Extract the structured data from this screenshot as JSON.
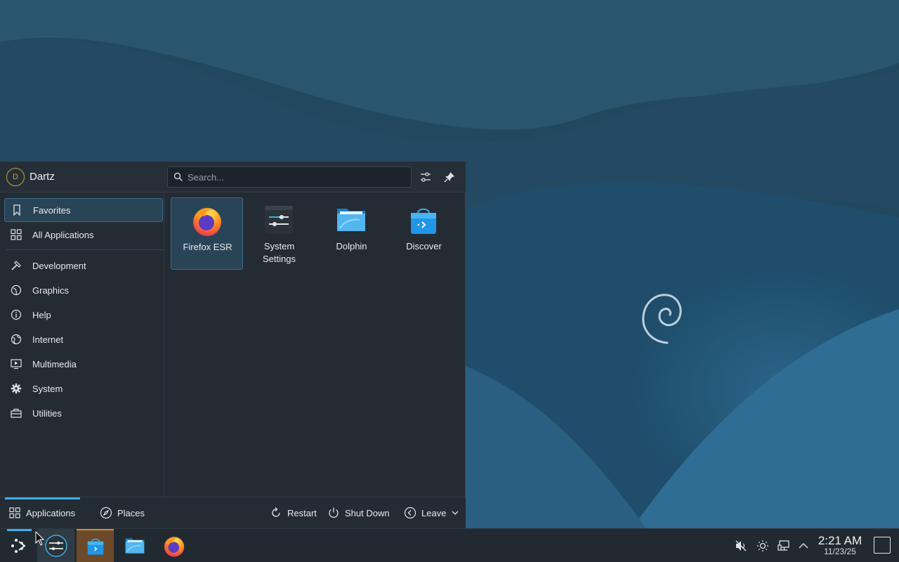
{
  "colors": {
    "accent": "#3daee9",
    "panel": "#232b33",
    "taskbar": "#222a31",
    "avatar_ring": "#c9a227"
  },
  "launcher": {
    "user": {
      "initial": "D",
      "name": "Dartz"
    },
    "search": {
      "placeholder": "Search...",
      "value": ""
    },
    "header_icons": [
      "configure-icon",
      "pin-icon"
    ],
    "sidebar": {
      "items": [
        {
          "label": "Favorites",
          "icon": "bookmark-icon",
          "active": true
        },
        {
          "label": "All Applications",
          "icon": "grid-icon",
          "active": false
        },
        {
          "label": "Development",
          "icon": "hammer-icon",
          "active": false
        },
        {
          "label": "Graphics",
          "icon": "graphics-icon",
          "active": false
        },
        {
          "label": "Help",
          "icon": "info-icon",
          "active": false
        },
        {
          "label": "Internet",
          "icon": "globe-icon",
          "active": false
        },
        {
          "label": "Multimedia",
          "icon": "monitor-play-icon",
          "active": false
        },
        {
          "label": "System",
          "icon": "gear-icon",
          "active": false
        },
        {
          "label": "Utilities",
          "icon": "toolbox-icon",
          "active": false
        }
      ]
    },
    "favorites": [
      {
        "label": "Firefox ESR",
        "icon": "firefox-icon",
        "active": true
      },
      {
        "label": "System Settings",
        "icon": "system-settings-icon",
        "active": false
      },
      {
        "label": "Dolphin",
        "icon": "dolphin-folder-icon",
        "active": false
      },
      {
        "label": "Discover",
        "icon": "discover-bag-icon",
        "active": false
      }
    ],
    "footer": {
      "tabs": [
        {
          "label": "Applications",
          "icon": "grid-icon",
          "active": true
        },
        {
          "label": "Places",
          "icon": "compass-icon",
          "active": false
        }
      ],
      "actions": [
        {
          "label": "Restart",
          "icon": "restart-icon"
        },
        {
          "label": "Shut Down",
          "icon": "power-icon"
        },
        {
          "label": "Leave",
          "icon": "leave-icon"
        }
      ]
    }
  },
  "taskbar": {
    "items": [
      {
        "name": "application-launcher",
        "icon": "kde-launcher-icon"
      },
      {
        "name": "system-settings",
        "icon": "system-settings-icon"
      },
      {
        "name": "discover",
        "icon": "discover-bag-icon"
      },
      {
        "name": "dolphin",
        "icon": "dolphin-folder-icon"
      },
      {
        "name": "firefox",
        "icon": "firefox-icon"
      }
    ],
    "tray": [
      "volume-muted-icon",
      "brightness-icon",
      "network-icon",
      "expand-tray-icon"
    ],
    "clock": {
      "time": "2:21 AM",
      "date": "11/23/25"
    }
  }
}
